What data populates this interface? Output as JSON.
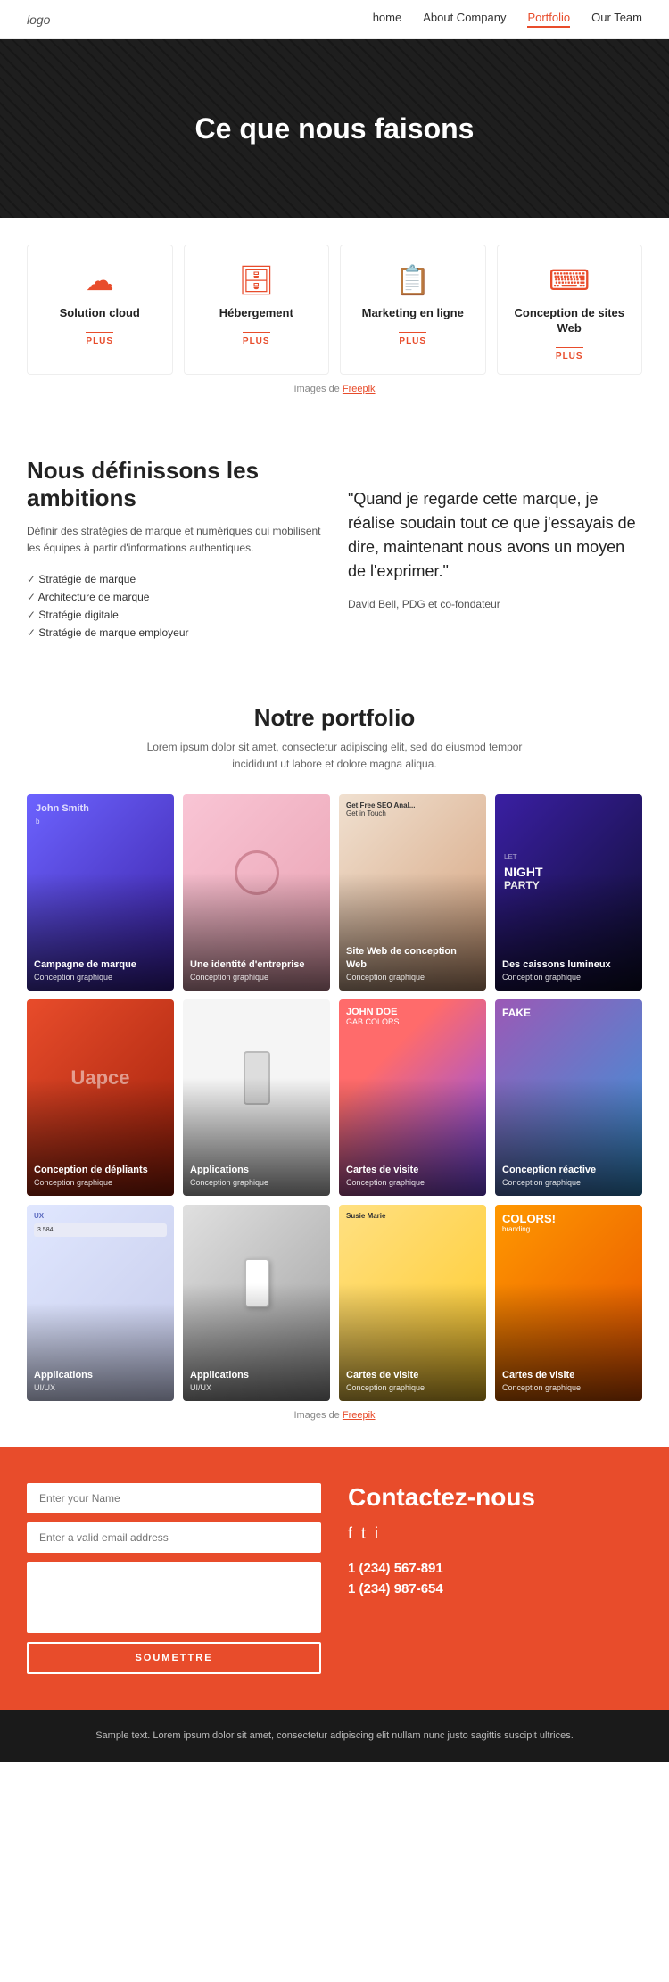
{
  "nav": {
    "logo": "logo",
    "links": [
      {
        "label": "home",
        "active": false
      },
      {
        "label": "About Company",
        "active": false
      },
      {
        "label": "Portfolio",
        "active": true
      },
      {
        "label": "Our Team",
        "active": false
      }
    ]
  },
  "hero": {
    "title": "Ce que nous faisons"
  },
  "services": {
    "items": [
      {
        "icon": "☁",
        "title": "Solution cloud",
        "plus": "PLUS"
      },
      {
        "icon": "🗄",
        "title": "Hébergement",
        "plus": "PLUS"
      },
      {
        "icon": "📋",
        "title": "Marketing en ligne",
        "plus": "PLUS"
      },
      {
        "icon": "⌨",
        "title": "Conception de sites Web",
        "plus": "PLUS"
      }
    ],
    "credit": "Images de",
    "credit_link": "Freepik"
  },
  "about": {
    "left": {
      "heading": "Nous définissons les ambitions",
      "body": "Définir des stratégies de marque et numériques qui mobilisent les équipes à partir d'informations authentiques.",
      "list": [
        "Stratégie de marque",
        "Architecture de marque",
        "Stratégie digitale",
        "Stratégie de marque employeur"
      ]
    },
    "right": {
      "quote": "\"Quand je regarde cette marque, je réalise soudain tout ce que j'essayais de dire, maintenant nous avons un moyen de l'exprimer.\"",
      "author": "David Bell, PDG et co-fondateur"
    }
  },
  "portfolio": {
    "title": "Notre portfolio",
    "subtitle": "Lorem ipsum dolor sit amet, consectetur adipiscing elit, sed do eiusmod tempor\nincididunt ut labore et dolore magna aliqua.",
    "items": [
      {
        "title": "Campagne de marque",
        "category": "Conception graphique",
        "bg": "bg-purple"
      },
      {
        "title": "Une identité d'entreprise",
        "category": "Conception graphique",
        "bg": "bg-pink"
      },
      {
        "title": "Site Web de conception Web",
        "category": "Conception graphique",
        "bg": "bg-brown"
      },
      {
        "title": "Des caissons lumineux",
        "category": "Conception graphique",
        "bg": "bg-dark"
      },
      {
        "title": "Conception de dépliants",
        "category": "Conception graphique",
        "bg": "bg-red"
      },
      {
        "title": "Applications",
        "category": "Conception graphique",
        "bg": "bg-phone"
      },
      {
        "title": "Cartes de visite",
        "category": "Conception graphique",
        "bg": "bg-multicolor"
      },
      {
        "title": "Conception réactive",
        "category": "Conception graphique",
        "bg": "bg-violet"
      },
      {
        "title": "Applications",
        "category": "UI/UX",
        "bg": "bg-light"
      },
      {
        "title": "Applications",
        "category": "UI/UX",
        "bg": "bg-phone"
      },
      {
        "title": "Cartes de visite",
        "category": "Conception graphique",
        "bg": "bg-card"
      },
      {
        "title": "Cartes de visite",
        "category": "Conception graphique",
        "bg": "bg-orange"
      }
    ],
    "credit": "Images de",
    "credit_link": "Freepik"
  },
  "contact": {
    "title": "Contactez-nous",
    "form": {
      "name_placeholder": "Enter your Name",
      "email_placeholder": "Enter a valid email address",
      "message_placeholder": "",
      "button_label": "SOUMETTRE"
    },
    "phones": [
      "1 (234) 567-891",
      "1 (234) 987-654"
    ],
    "social": [
      "f",
      "t",
      "i"
    ]
  },
  "footer": {
    "text": "Sample text. Lorem ipsum dolor sit amet, consectetur adipiscing elit nullam nunc justo sagittis suscipit ultrices."
  }
}
